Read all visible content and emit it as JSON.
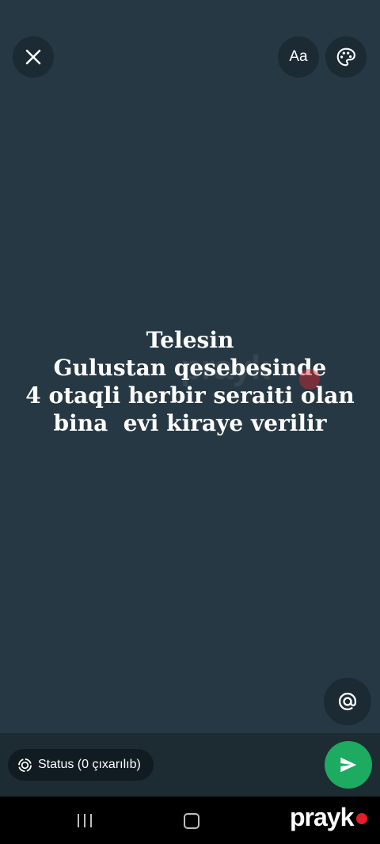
{
  "editor": {
    "status_text": "Telesin\nGulustan qesebesinde\n4 otaqli herbir seraiti olan\nbina  evi kiraye verilir",
    "background_color": "#263843",
    "font_button_label": "Aa",
    "icons": {
      "close": "close-icon",
      "palette": "palette-icon",
      "mention": "at-sign-icon",
      "send": "send-icon",
      "status": "status-ring-icon"
    }
  },
  "bottom_bar": {
    "audience_label": "Status (0 çıxarılıb)",
    "send_color": "#1daa61"
  },
  "watermark": {
    "logo_text": "prayk",
    "dot_color": "#e21e26"
  }
}
